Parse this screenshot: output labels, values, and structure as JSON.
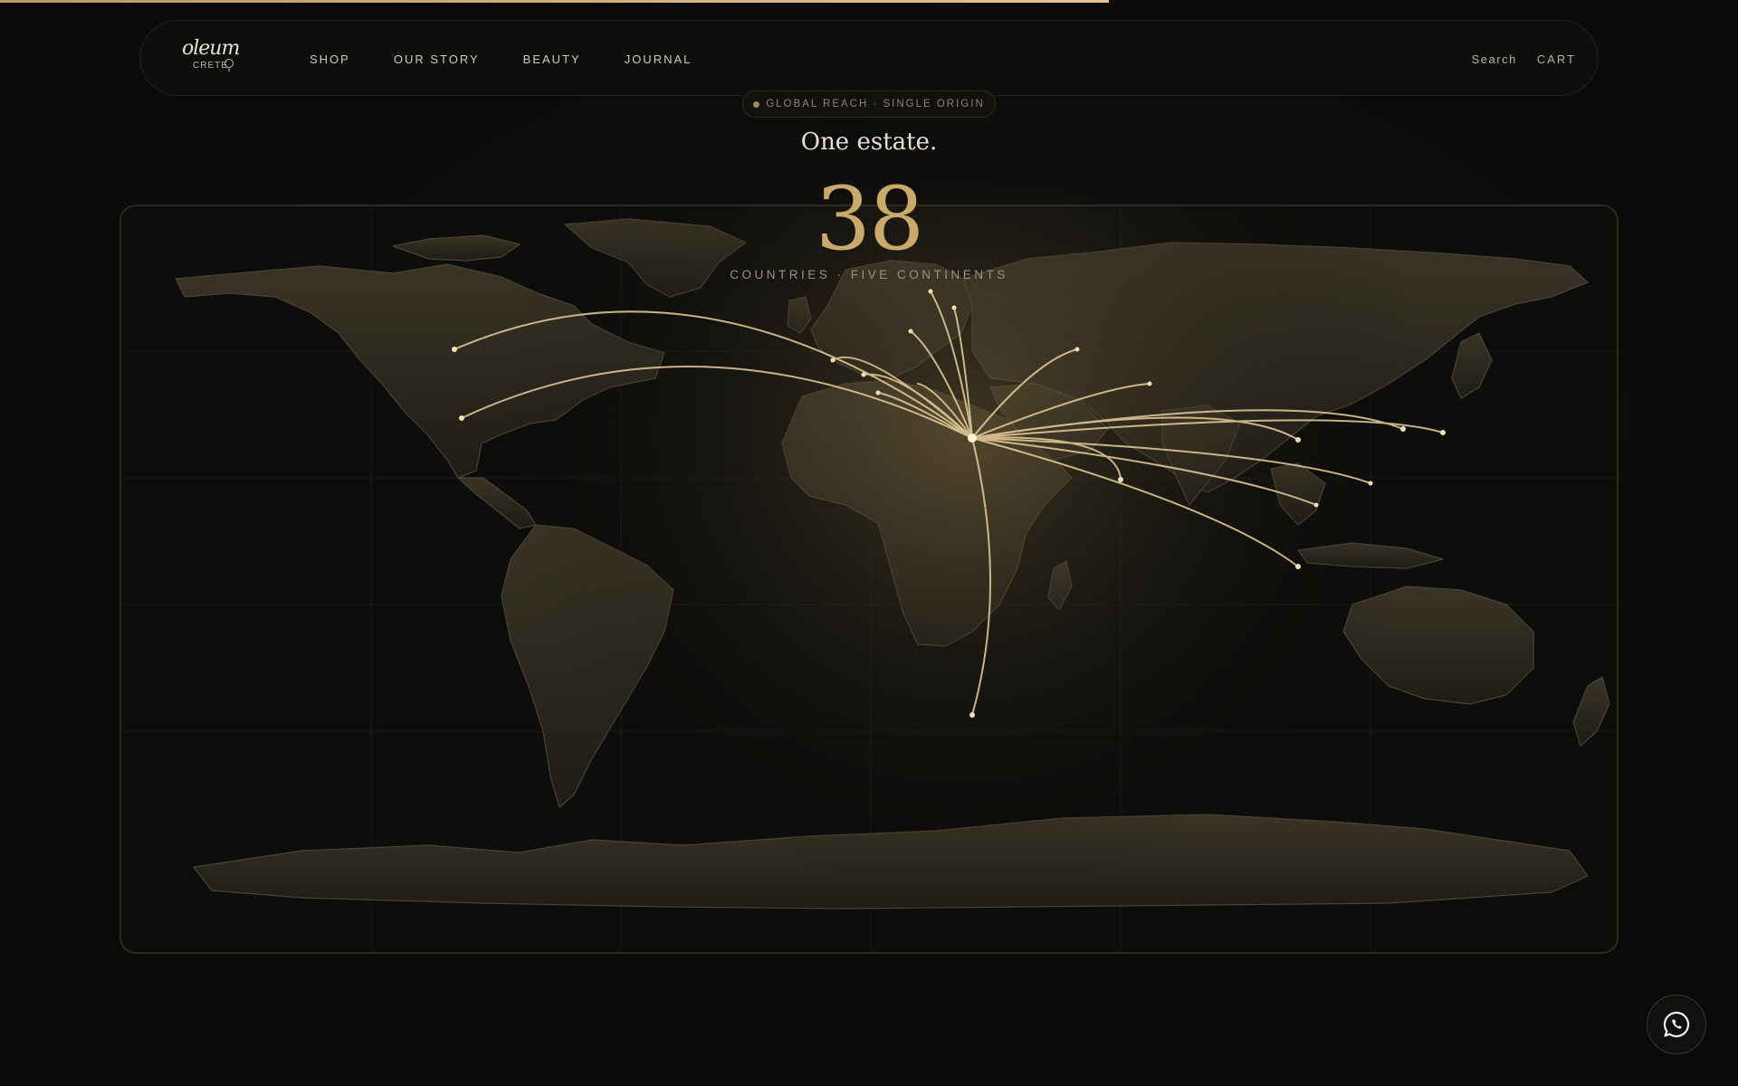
{
  "progress": {
    "fraction": 0.638
  },
  "header": {
    "logo": {
      "word": "oleum",
      "sub": "CRETE"
    },
    "nav": [
      {
        "id": "shop",
        "label": "SHOP"
      },
      {
        "id": "our-story",
        "label": "OUR STORY"
      },
      {
        "id": "beauty",
        "label": "BEAUTY"
      },
      {
        "id": "journal",
        "label": "JOURNAL"
      }
    ],
    "search_label": "Search",
    "cart_label": "CART"
  },
  "hero": {
    "eyebrow": "GLOBAL REACH · SINGLE ORIGIN",
    "headline": "One estate.",
    "stat_number": "38",
    "stat_label": "COUNTRIES · FIVE CONTINENTS"
  },
  "colors": {
    "accent_gold": "#c9a96c",
    "arc_gold": "#e8cf9c",
    "land": "#2a261d",
    "background": "#0b0b0a"
  },
  "icons": {
    "whatsapp": "whatsapp-icon"
  }
}
